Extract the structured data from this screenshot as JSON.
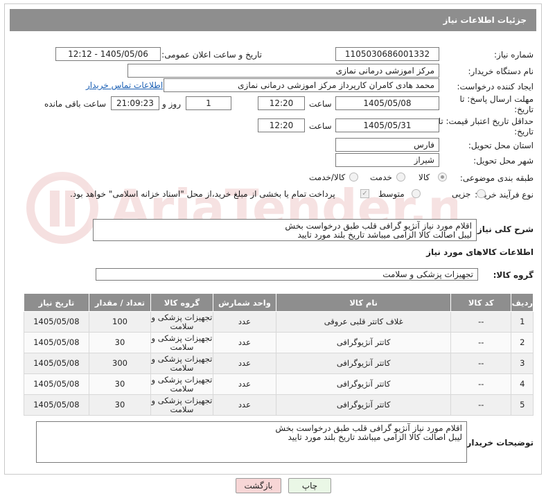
{
  "header": {
    "title": "جزئیات اطلاعات نیاز"
  },
  "form": {
    "need_number_label": "شماره نیاز:",
    "need_number": "1105030686001332",
    "announce_label": "تاریخ و ساعت اعلان عمومی:",
    "announce_value": "1405/05/06 - 12:12",
    "buyer_org_label": "نام دستگاه خریدار:",
    "buyer_org": "مرکز اموزشی درمانی نمازی",
    "creator_label": "ایجاد کننده درخواست:",
    "creator": "محمد هادی کامران کارپرداز مرکز اموزشی درمانی نمازی",
    "contact_link": "اطلاعات تماس خریدار",
    "deadline_label": "مهلت ارسال پاسخ: تا تاریخ:",
    "deadline_date": "1405/05/08",
    "time_label": "ساعت",
    "deadline_time": "12:20",
    "days_value": "1",
    "days_label": "روز و",
    "remaining_time": "21:09:23",
    "remaining_label": "ساعت باقی مانده",
    "validity_label": "حداقل تاریخ اعتبار قیمت: تا تاریخ:",
    "validity_date": "1405/05/31",
    "validity_time": "12:20",
    "province_label": "استان محل تحویل:",
    "province": "فارس",
    "city_label": "شهر محل تحویل:",
    "city": "شیراز",
    "category_label": "طبقه بندی موضوعی:",
    "category_options": [
      "کالا",
      "خدمت",
      "کالا/خدمت"
    ],
    "process_label": "نوع فرآیند خرید :",
    "process_options": [
      "جزیی",
      "متوسط"
    ],
    "payment_text": "پرداخت تمام یا بخشی از مبلغ خرید،از محل \"اسناد خزانه اسلامی\" خواهد بود."
  },
  "description": {
    "label": "شرح کلی نیاز:",
    "text": "اقلام مورد نیاز آنژیو گرافی قلب طبق درخواست بخش\nلیبل اصالت کالا الزامی میباشد تاریخ بلند مورد تایید"
  },
  "goods": {
    "section_title": "اطلاعات کالاهای مورد نیاز",
    "group_label": "گروه کالا:",
    "group_value": "تجهیزات پزشکی و سلامت",
    "columns": [
      "ردیف",
      "کد کالا",
      "نام کالا",
      "واحد شمارش",
      "گروه کالا",
      "تعداد / مقدار",
      "تاریخ نیاز"
    ],
    "rows": [
      {
        "n": "1",
        "code": "--",
        "name": "غلاف کاتتر قلبی عروقی",
        "unit": "عدد",
        "group": "تجهیزات پزشکی و سلامت",
        "qty": "100",
        "date": "1405/05/08"
      },
      {
        "n": "2",
        "code": "--",
        "name": "کاتتر آنژیوگرافی",
        "unit": "عدد",
        "group": "تجهیزات پزشکی و سلامت",
        "qty": "30",
        "date": "1405/05/08"
      },
      {
        "n": "3",
        "code": "--",
        "name": "کاتتر آنژیوگرافی",
        "unit": "عدد",
        "group": "تجهیزات پزشکی و سلامت",
        "qty": "300",
        "date": "1405/05/08"
      },
      {
        "n": "4",
        "code": "--",
        "name": "کاتتر آنژیوگرافی",
        "unit": "عدد",
        "group": "تجهیزات پزشکی و سلامت",
        "qty": "30",
        "date": "1405/05/08"
      },
      {
        "n": "5",
        "code": "--",
        "name": "کاتتر آنژیوگرافی",
        "unit": "عدد",
        "group": "تجهیزات پزشکی و سلامت",
        "qty": "30",
        "date": "1405/05/08"
      }
    ]
  },
  "buyer_notes": {
    "label": "توضیحات خریدار:",
    "text": "اقلام مورد نیاز آنژیو گرافی قلب طبق درخواست بخش\nلیبل اصالت کالا الزامی میباشد تاریخ بلند مورد تایید"
  },
  "buttons": {
    "print": "چاپ",
    "back": "بازگشت"
  },
  "watermark": {
    "text": "AriaTender.neT"
  },
  "colors": {
    "header": "#8e8e8e",
    "link": "#1a5fb4",
    "back_button": "#f7d6d6",
    "print_button": "#eaf7e6"
  }
}
